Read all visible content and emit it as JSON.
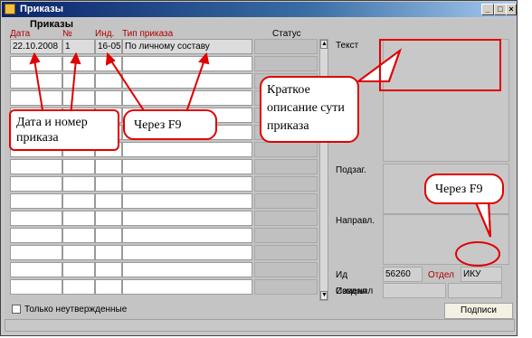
{
  "window": {
    "title": "Приказы"
  },
  "block_title": "Приказы",
  "columns": {
    "date": "Дата",
    "num": "№",
    "ind": "Инд.",
    "type": "Тип приказа",
    "status": "Статус"
  },
  "rows": [
    {
      "date": "22.10.2008",
      "num": "1",
      "ind": "16-05",
      "type": "По личному составу"
    }
  ],
  "detail": {
    "text_label": "Текст",
    "subtitle_label": "Подзаг.",
    "direction_label": "Направл.",
    "id_label": "Ид",
    "id_value": "56260",
    "dept_label": "Отдел",
    "dept_value": "ИКУ",
    "created_label": "Создал",
    "changed_label": "Изменил"
  },
  "filter": {
    "unconfirmed_label": "Только неутвержденные"
  },
  "buttons": {
    "signatures": "Подписи"
  },
  "annotations": {
    "date_num": "Дата и номер приказа",
    "f9_left": "Через F9",
    "short_desc": "Краткое описание сути приказа",
    "f9_right": "Через F9"
  },
  "colors": {
    "accent": "#e00000",
    "header_text": "#b00000",
    "title_bar": "#0a246a"
  }
}
